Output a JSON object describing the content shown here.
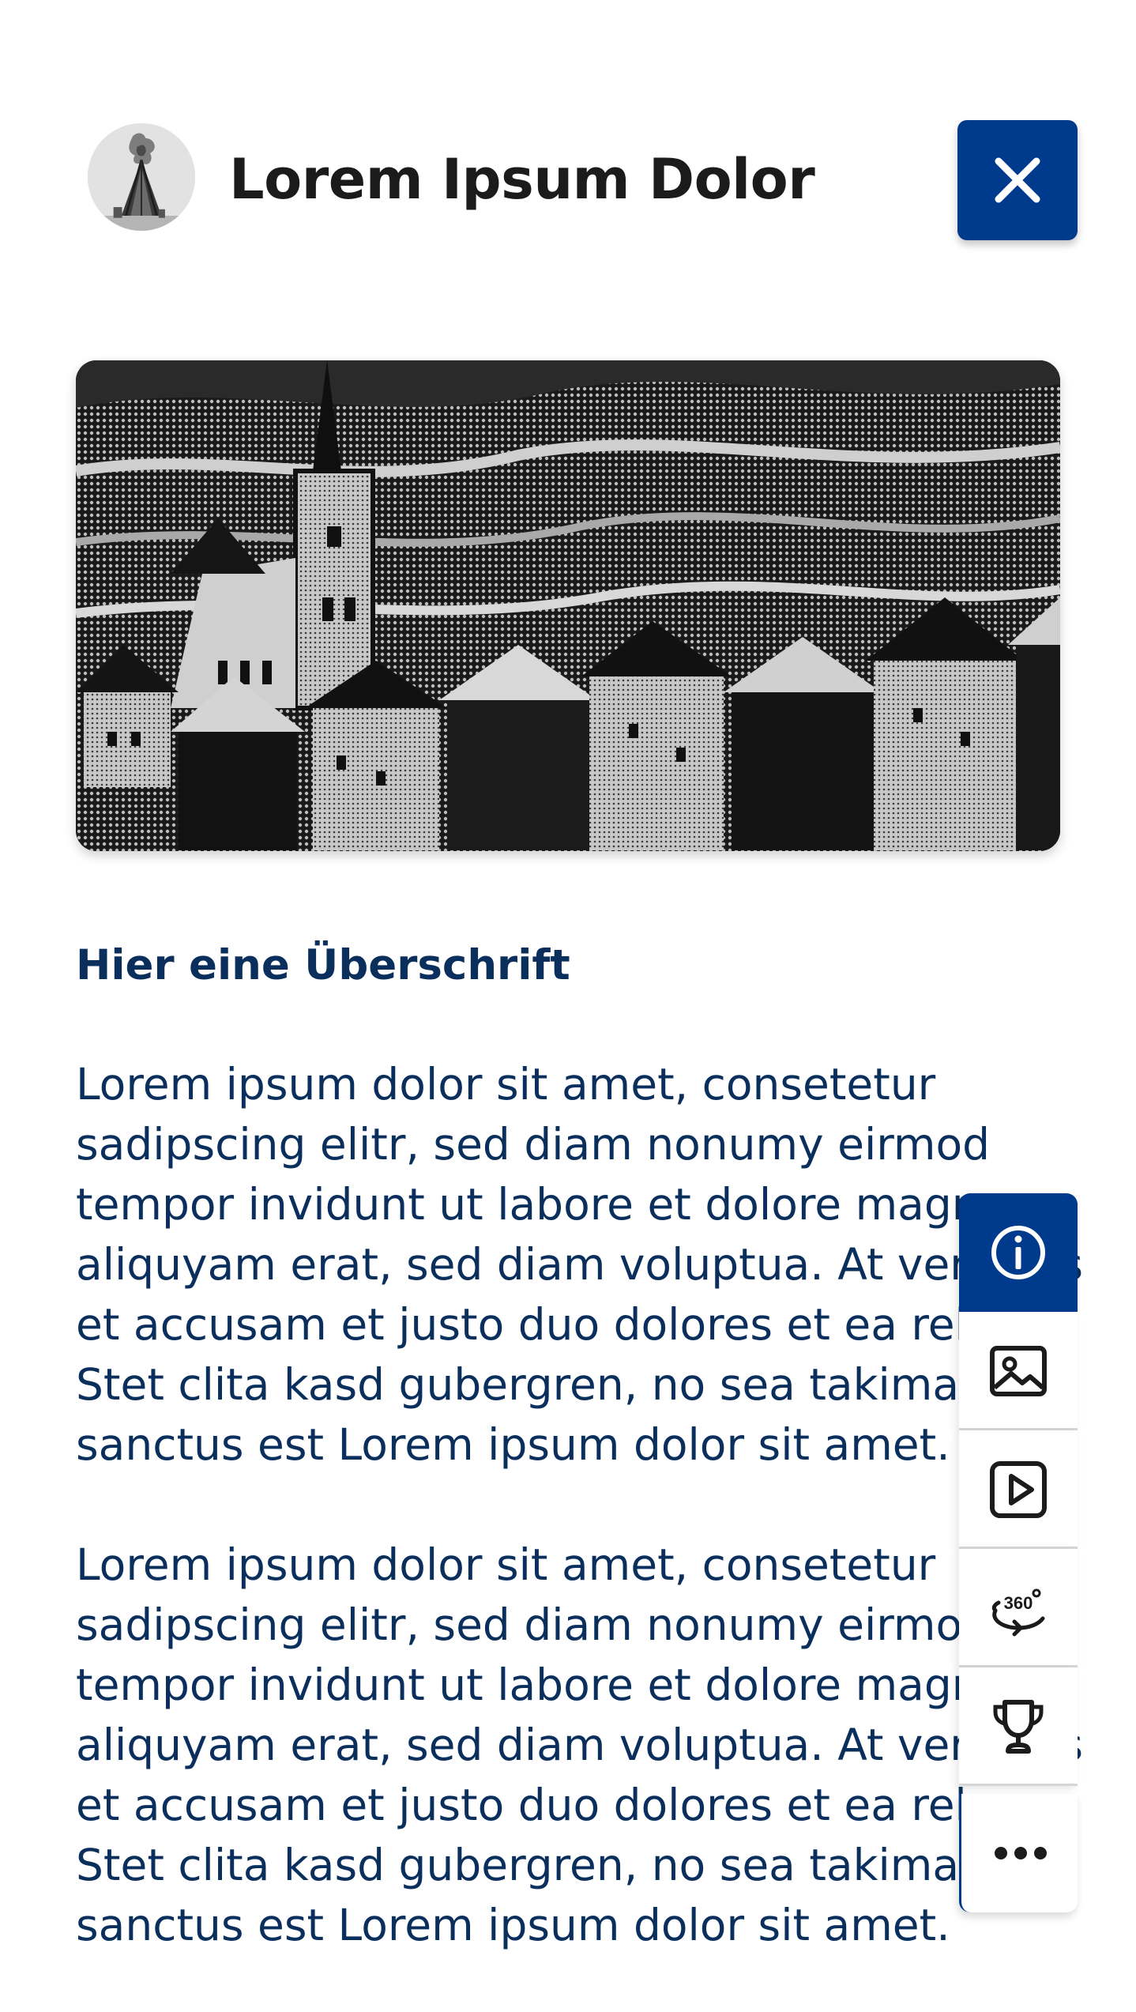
{
  "header": {
    "title": "Lorem Ipsum Dolor",
    "avatar_icon": "bonfire-avatar-icon",
    "close_icon": "close-icon"
  },
  "hero": {
    "icon": "village-engraving-image"
  },
  "content": {
    "heading": "Hier eine Überschrift",
    "paragraphs": [
      {
        "lines": [
          "Lorem ipsum dolor sit amet, consetetur",
          "sadipscing elitr, sed diam nonumy eirmod",
          "tempor invidunt ut labore et dolore magna",
          "aliquyam erat, sed diam voluptua. At vero eos",
          "et accusam et justo duo dolores et ea rebum.",
          "Stet clita kasd gubergren, no sea takimata",
          "sanctus est Lorem ipsum dolor sit amet."
        ]
      },
      {
        "lines": [
          "Lorem ipsum dolor sit amet, consetetur",
          "sadipscing elitr, sed diam nonumy eirmod",
          "tempor invidunt ut labore et dolore magna",
          "aliquyam erat, sed diam voluptua. At vero eos",
          "et accusam et justo duo dolores et ea rebum.",
          "Stet clita kasd gubergren, no sea takimata",
          "sanctus est Lorem ipsum dolor sit amet."
        ]
      }
    ]
  },
  "toolbar": {
    "items": [
      {
        "id": "info",
        "icon": "info-icon",
        "active": true
      },
      {
        "id": "images",
        "icon": "image-icon",
        "active": false
      },
      {
        "id": "video",
        "icon": "play-video-icon",
        "active": false
      },
      {
        "id": "view360",
        "icon": "view-360-icon",
        "active": false
      },
      {
        "id": "achievements",
        "icon": "trophy-icon",
        "active": false
      },
      {
        "id": "more",
        "icon": "more-dots-icon",
        "active": false
      }
    ]
  },
  "colors": {
    "primary": "#003a8c",
    "text": "#0b2f5c",
    "title": "#1b1b1b",
    "background": "#ffffff"
  }
}
